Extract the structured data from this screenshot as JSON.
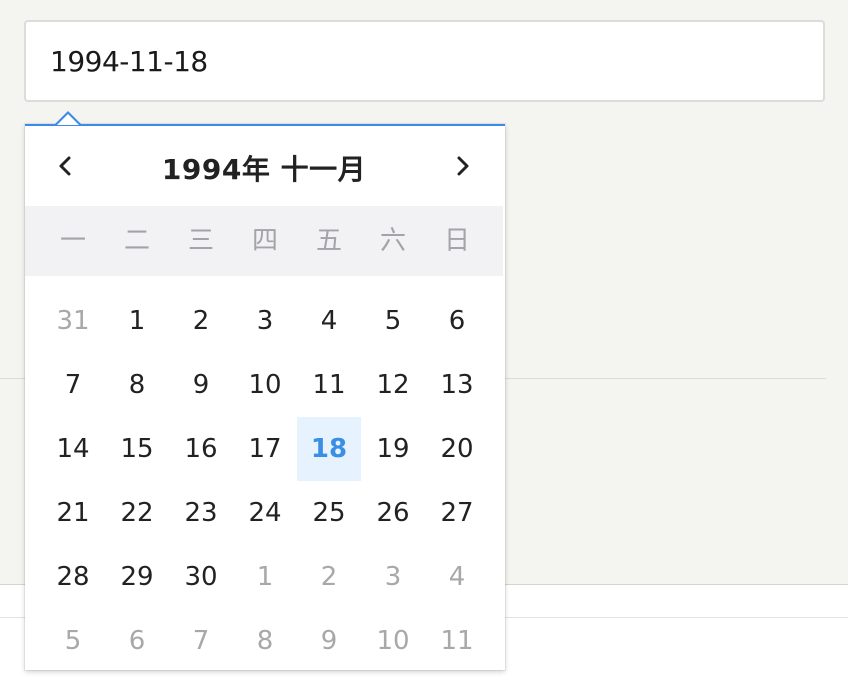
{
  "date_input": {
    "value": "1994-11-18"
  },
  "picker": {
    "title": "1994年 十一月",
    "prev_icon": "chevron-left-icon",
    "next_icon": "chevron-right-icon",
    "accent_color": "#3f8ae8",
    "selected_bg": "#e6f2fd",
    "selected_color": "#3a8ee6",
    "weekdays": [
      "一",
      "二",
      "三",
      "四",
      "五",
      "六",
      "日"
    ],
    "selected_day": "18",
    "weeks": [
      [
        {
          "d": "31",
          "other": true
        },
        {
          "d": "1"
        },
        {
          "d": "2"
        },
        {
          "d": "3"
        },
        {
          "d": "4"
        },
        {
          "d": "5"
        },
        {
          "d": "6"
        }
      ],
      [
        {
          "d": "7"
        },
        {
          "d": "8"
        },
        {
          "d": "9"
        },
        {
          "d": "10"
        },
        {
          "d": "11"
        },
        {
          "d": "12"
        },
        {
          "d": "13"
        }
      ],
      [
        {
          "d": "14"
        },
        {
          "d": "15"
        },
        {
          "d": "16"
        },
        {
          "d": "17"
        },
        {
          "d": "18",
          "selected": true
        },
        {
          "d": "19"
        },
        {
          "d": "20"
        }
      ],
      [
        {
          "d": "21"
        },
        {
          "d": "22"
        },
        {
          "d": "23"
        },
        {
          "d": "24"
        },
        {
          "d": "25"
        },
        {
          "d": "26"
        },
        {
          "d": "27"
        }
      ],
      [
        {
          "d": "28"
        },
        {
          "d": "29"
        },
        {
          "d": "30"
        },
        {
          "d": "1",
          "other": true
        },
        {
          "d": "2",
          "other": true
        },
        {
          "d": "3",
          "other": true
        },
        {
          "d": "4",
          "other": true
        }
      ],
      [
        {
          "d": "5",
          "other": true
        },
        {
          "d": "6",
          "other": true
        },
        {
          "d": "7",
          "other": true
        },
        {
          "d": "8",
          "other": true
        },
        {
          "d": "9",
          "other": true
        },
        {
          "d": "10",
          "other": true
        },
        {
          "d": "11",
          "other": true
        }
      ]
    ]
  }
}
